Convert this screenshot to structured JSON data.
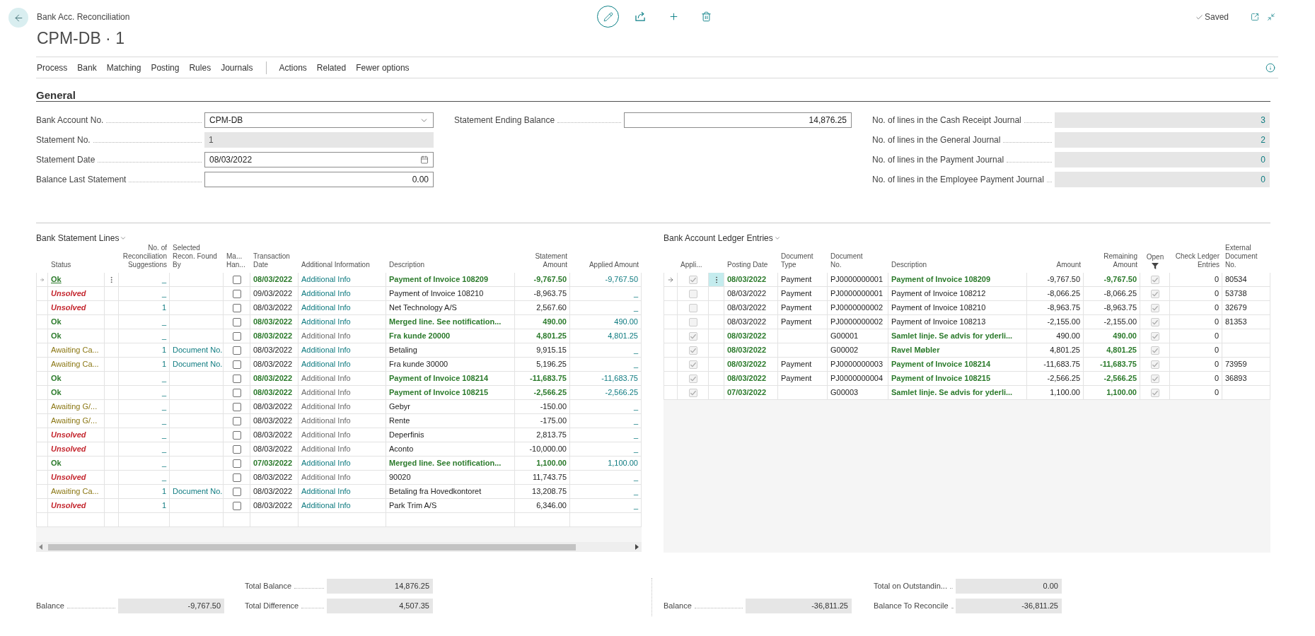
{
  "header": {
    "breadcrumb": "Bank Acc. Reconciliation",
    "title": "CPM-DB · 1",
    "save_status": "Saved"
  },
  "action_bar": {
    "groups": [
      [
        "Process",
        "Bank",
        "Matching",
        "Posting",
        "Rules",
        "Journals"
      ],
      [
        "Actions",
        "Related",
        "Fewer options"
      ]
    ]
  },
  "general": {
    "title": "General",
    "columns": [
      [
        {
          "label": "Bank Account No.",
          "kind": "dropdown",
          "value": "CPM-DB"
        },
        {
          "label": "Statement No.",
          "kind": "readonly",
          "value": "1"
        },
        {
          "label": "Statement Date",
          "kind": "date",
          "value": "08/03/2022"
        },
        {
          "label": "Balance Last Statement",
          "kind": "number",
          "value": "0.00"
        }
      ],
      [
        {
          "label": "Statement Ending Balance",
          "kind": "number",
          "value": "14,876.25"
        }
      ],
      [
        {
          "label": "No. of lines in the Cash Receipt Journal",
          "kind": "drilldown",
          "value": "3"
        },
        {
          "label": "No. of lines in the General Journal",
          "kind": "drilldown",
          "value": "2"
        },
        {
          "label": "No. of lines in the Payment Journal",
          "kind": "drilldown",
          "value": "0"
        },
        {
          "label": "No. of lines in the Employee Payment Journal",
          "kind": "drilldown",
          "value": "0"
        }
      ]
    ]
  },
  "statement_lines": {
    "title": "Bank Statement Lines",
    "columns": [
      "Status",
      "No. of\nReconciliation\nSuggestions",
      "Selected\nRecon. Found\nBy",
      "Ma...\nHan...",
      "Transaction\nDate",
      "Additional Information",
      "Description",
      "Statement\nAmount",
      "Applied Amount"
    ],
    "rows": [
      {
        "selected": true,
        "status": "Ok",
        "kind": "ok",
        "suggestions": "_",
        "manually_handled": false,
        "transaction_date": "08/03/2022",
        "additional_info": "Additional Info",
        "info_linked": true,
        "description": "Payment of Invoice 108209",
        "statement_amount": "-9,767.50",
        "applied_amount": "-9,767.50"
      },
      {
        "selected": false,
        "status": "Unsolved",
        "kind": "unsolved",
        "suggestions": "_",
        "manually_handled": false,
        "transaction_date": "09/03/2022",
        "additional_info": "Additional Info",
        "info_linked": true,
        "description": "Payment of Invoice 108210",
        "statement_amount": "-8,963.75",
        "applied_amount": "_"
      },
      {
        "selected": false,
        "status": "Unsolved",
        "kind": "unsolved",
        "suggestions": "1",
        "manually_handled": false,
        "transaction_date": "08/03/2022",
        "additional_info": "Additional Info",
        "info_linked": true,
        "description": "Net Technology A/S",
        "statement_amount": "2,567.60",
        "applied_amount": "_"
      },
      {
        "selected": false,
        "status": "Ok",
        "kind": "ok",
        "suggestions": "_",
        "manually_handled": false,
        "transaction_date": "08/03/2022",
        "additional_info": "Additional Info",
        "info_linked": true,
        "description": "Merged line. See notification...",
        "statement_amount": "490.00",
        "applied_amount": "490.00"
      },
      {
        "selected": false,
        "status": "Ok",
        "kind": "ok",
        "suggestions": "_",
        "manually_handled": false,
        "transaction_date": "08/03/2022",
        "additional_info": "Additional Info",
        "info_linked": false,
        "description": "Fra kunde 20000",
        "statement_amount": "4,801.25",
        "applied_amount": "4,801.25"
      },
      {
        "selected": false,
        "status": "Awaiting Ca...",
        "kind": "awaiting",
        "suggestions": "1",
        "found_by": "Document No.",
        "manually_handled": false,
        "transaction_date": "08/03/2022",
        "additional_info": "Additional Info",
        "info_linked": true,
        "description": "Betaling",
        "statement_amount": "9,915.15",
        "applied_amount": "_"
      },
      {
        "selected": false,
        "status": "Awaiting Ca...",
        "kind": "awaiting",
        "suggestions": "1",
        "found_by": "Document No.",
        "manually_handled": false,
        "transaction_date": "08/03/2022",
        "additional_info": "Additional Info",
        "info_linked": true,
        "description": "Fra kunde 30000",
        "statement_amount": "5,196.25",
        "applied_amount": "_"
      },
      {
        "selected": false,
        "status": "Ok",
        "kind": "ok",
        "suggestions": "_",
        "manually_handled": false,
        "transaction_date": "08/03/2022",
        "additional_info": "Additional Info",
        "info_linked": false,
        "description": "Payment of Invoice 108214",
        "statement_amount": "-11,683.75",
        "applied_amount": "-11,683.75"
      },
      {
        "selected": false,
        "status": "Ok",
        "kind": "ok",
        "suggestions": "_",
        "manually_handled": false,
        "transaction_date": "08/03/2022",
        "additional_info": "Additional Info",
        "info_linked": false,
        "description": "Payment of Invoice 108215",
        "statement_amount": "-2,566.25",
        "applied_amount": "-2,566.25"
      },
      {
        "selected": false,
        "status": "Awaiting G/...",
        "kind": "awaiting",
        "suggestions": "_",
        "manually_handled": false,
        "transaction_date": "08/03/2022",
        "additional_info": "Additional Info",
        "info_linked": false,
        "description": "Gebyr",
        "statement_amount": "-150.00",
        "applied_amount": "_"
      },
      {
        "selected": false,
        "status": "Awaiting G/...",
        "kind": "awaiting",
        "suggestions": "_",
        "manually_handled": false,
        "transaction_date": "08/03/2022",
        "additional_info": "Additional Info",
        "info_linked": false,
        "description": "Rente",
        "statement_amount": "-175.00",
        "applied_amount": "_"
      },
      {
        "selected": false,
        "status": "Unsolved",
        "kind": "unsolved",
        "suggestions": "_",
        "manually_handled": false,
        "transaction_date": "08/03/2022",
        "additional_info": "Additional Info",
        "info_linked": false,
        "description": "Deperfinis",
        "statement_amount": "2,813.75",
        "applied_amount": "_"
      },
      {
        "selected": false,
        "status": "Unsolved",
        "kind": "unsolved",
        "suggestions": "_",
        "manually_handled": false,
        "transaction_date": "08/03/2022",
        "additional_info": "Additional Info",
        "info_linked": false,
        "description": "Aconto",
        "statement_amount": "-10,000.00",
        "applied_amount": "_"
      },
      {
        "selected": false,
        "status": "Ok",
        "kind": "ok",
        "suggestions": "_",
        "manually_handled": false,
        "transaction_date": "07/03/2022",
        "additional_info": "Additional Info",
        "info_linked": true,
        "description": "Merged line. See notification...",
        "statement_amount": "1,100.00",
        "applied_amount": "1,100.00"
      },
      {
        "selected": false,
        "status": "Unsolved",
        "kind": "unsolved",
        "suggestions": "_",
        "manually_handled": false,
        "transaction_date": "08/03/2022",
        "additional_info": "Additional Info",
        "info_linked": false,
        "description": "90020",
        "statement_amount": "11,743.75",
        "applied_amount": "_"
      },
      {
        "selected": false,
        "status": "Awaiting Ca...",
        "kind": "awaiting",
        "suggestions": "1",
        "found_by": "Document No.",
        "manually_handled": false,
        "transaction_date": "08/03/2022",
        "additional_info": "Additional Info",
        "info_linked": true,
        "description": "Betaling fra Hovedkontoret",
        "statement_amount": "13,208.75",
        "applied_amount": "_"
      },
      {
        "selected": false,
        "status": "Unsolved",
        "kind": "unsolved",
        "suggestions": "1",
        "manually_handled": false,
        "transaction_date": "08/03/2022",
        "additional_info": "Additional Info",
        "info_linked": true,
        "description": "Park Trim A/S",
        "statement_amount": "6,346.00",
        "applied_amount": "_"
      }
    ]
  },
  "ledger_entries": {
    "title": "Bank Account Ledger Entries",
    "columns": [
      {
        "label": "Appli..."
      },
      {
        "label": "Posting Date"
      },
      {
        "label": "Document\nType"
      },
      {
        "label": "Document\nNo."
      },
      {
        "label": "Description"
      },
      {
        "label": "Amount"
      },
      {
        "label": "Remaining\nAmount"
      },
      {
        "label": "Open",
        "filtered": true
      },
      {
        "label": "Check Ledger\nEntries"
      },
      {
        "label": "External\nDocument\nNo."
      }
    ],
    "rows": [
      {
        "selected": true,
        "applied": true,
        "posting_date": "08/03/2022",
        "document_type": "Payment",
        "document_no": "PJ0000000001",
        "description": "Payment of Invoice 108209",
        "amount": "-9,767.50",
        "remaining_amount": "-9,767.50",
        "open": true,
        "check_ledger_entries": "0",
        "external_document_no": "80534"
      },
      {
        "selected": false,
        "applied": false,
        "posting_date": "08/03/2022",
        "document_type": "Payment",
        "document_no": "PJ0000000001",
        "description": "Payment of Invoice 108212",
        "amount": "-8,066.25",
        "remaining_amount": "-8,066.25",
        "open": true,
        "check_ledger_entries": "0",
        "external_document_no": "53738"
      },
      {
        "selected": false,
        "applied": false,
        "posting_date": "08/03/2022",
        "document_type": "Payment",
        "document_no": "PJ0000000002",
        "description": "Payment of Invoice 108210",
        "amount": "-8,963.75",
        "remaining_amount": "-8,963.75",
        "open": true,
        "check_ledger_entries": "0",
        "external_document_no": "32679"
      },
      {
        "selected": false,
        "applied": false,
        "posting_date": "08/03/2022",
        "document_type": "Payment",
        "document_no": "PJ0000000002",
        "description": "Payment of Invoice 108213",
        "amount": "-2,155.00",
        "remaining_amount": "-2,155.00",
        "open": true,
        "check_ledger_entries": "0",
        "external_document_no": "81353"
      },
      {
        "selected": false,
        "applied": true,
        "posting_date": "08/03/2022",
        "document_no": "G00001",
        "description": "Samlet linje. Se advis for yderli...",
        "amount": "490.00",
        "remaining_amount": "490.00",
        "open": true,
        "check_ledger_entries": "0"
      },
      {
        "selected": false,
        "applied": true,
        "posting_date": "08/03/2022",
        "document_no": "G00002",
        "description": "Ravel Møbler",
        "amount": "4,801.25",
        "remaining_amount": "4,801.25",
        "open": true,
        "check_ledger_entries": "0"
      },
      {
        "selected": false,
        "applied": true,
        "posting_date": "08/03/2022",
        "document_type": "Payment",
        "document_no": "PJ0000000003",
        "description": "Payment of Invoice 108214",
        "amount": "-11,683.75",
        "remaining_amount": "-11,683.75",
        "open": true,
        "check_ledger_entries": "0",
        "external_document_no": "73959"
      },
      {
        "selected": false,
        "applied": true,
        "posting_date": "08/03/2022",
        "document_type": "Payment",
        "document_no": "PJ0000000004",
        "description": "Payment of Invoice 108215",
        "amount": "-2,566.25",
        "remaining_amount": "-2,566.25",
        "open": true,
        "check_ledger_entries": "0",
        "external_document_no": "36893"
      },
      {
        "selected": false,
        "applied": true,
        "posting_date": "07/03/2022",
        "document_no": "G00003",
        "description": "Samlet linje. Se advis for yderli...",
        "amount": "1,100.00",
        "remaining_amount": "1,100.00",
        "open": true,
        "check_ledger_entries": "0"
      }
    ]
  },
  "statement_totals": {
    "columns": [
      [
        {
          "label": "Balance",
          "value": "-9,767.50"
        }
      ],
      [
        {
          "label": "Total Balance",
          "value": "14,876.25"
        },
        {
          "label": "Total Difference",
          "value": "4,507.35"
        }
      ]
    ]
  },
  "ledger_totals": {
    "columns": [
      [
        {
          "label": "Balance",
          "value": "-36,811.25"
        }
      ],
      [
        {
          "label": "Total on Outstandin...",
          "value": "0.00"
        },
        {
          "label": "Balance To Reconcile",
          "value": "-36,811.25"
        }
      ]
    ]
  }
}
